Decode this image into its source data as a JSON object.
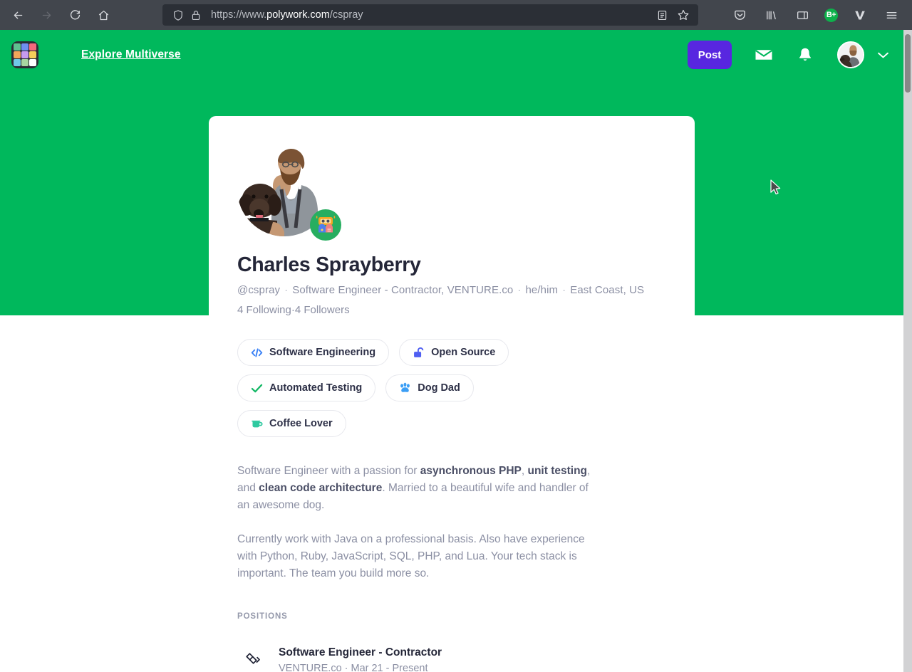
{
  "browser": {
    "back_label": "Back",
    "forward_label": "Forward",
    "reload_label": "Reload",
    "home_label": "Home",
    "url_scheme": "https://www.",
    "url_host": "polywork.com",
    "url_path": "/cspray",
    "reader_label": "Reader View",
    "bookmark_label": "Bookmark this page",
    "pocket_label": "Save to Pocket",
    "library_label": "Library",
    "sidebar_label": "Sidebar",
    "extension_badge": "B+",
    "vpn_label": "V",
    "menu_label": "Open application menu"
  },
  "app_header": {
    "logo_name": "Polywork",
    "logo_colors": [
      "#5fbf8f",
      "#6f8ff0",
      "#f4697c",
      "#f2a65a",
      "#c79bf0",
      "#f5cf5a",
      "#6fc8e8",
      "#a9d6a2",
      "#ffffff"
    ],
    "explore_label": "Explore Multiverse",
    "post_label": "Post",
    "messages_label": "Messages",
    "notifications_label": "Notifications",
    "avatar_label": "Charles Sprayberry",
    "account_menu_label": "Account menu",
    "brand_green": "#00b85c",
    "post_purple": "#5826e0"
  },
  "profile": {
    "name": "Charles Sprayberry",
    "handle": "@cspray",
    "title": "Software Engineer - Contractor, VENTURE.co",
    "pronouns": "he/him",
    "location": "East Coast, US",
    "following": "4 Following",
    "followers": "4 Followers",
    "separator": "·",
    "badge_name": "robot-badge",
    "avatar_alt": "Bearded man with glasses holding a dark brown dog"
  },
  "chips": [
    {
      "label": "Software Engineering",
      "icon": "code-icon",
      "color": "#3b82f6"
    },
    {
      "label": "Open Source",
      "icon": "unlock-icon",
      "color": "#4f5ff2"
    },
    {
      "label": "Automated Testing",
      "icon": "check-icon",
      "color": "#14b866"
    },
    {
      "label": "Dog Dad",
      "icon": "paw-icon",
      "color": "#3b9ef5"
    },
    {
      "label": "Coffee Lover",
      "icon": "coffee-pot-icon",
      "color": "#2fc9a0"
    }
  ],
  "bio": {
    "p1_a": "Software Engineer with a passion for ",
    "p1_b1": "asynchronous PHP",
    "p1_c": ", ",
    "p1_b2": "unit testing",
    "p1_d": ", and ",
    "p1_b3": "clean code architecture",
    "p1_e": ". Married to a beautiful wife and handler of an awesome dog.",
    "p2": "Currently work with Java on a professional basis. Also have experience with Python, Ruby, JavaScript, SQL, PHP, and Lua. Your tech stack is important. The team you build more so."
  },
  "positions_section": {
    "heading": "POSITIONS",
    "items": [
      {
        "title": "Software Engineer - Contractor",
        "company": "VENTURE.co",
        "dates": "Mar 21 - Present",
        "separator": "·",
        "icon": "diamond-icon"
      }
    ]
  }
}
